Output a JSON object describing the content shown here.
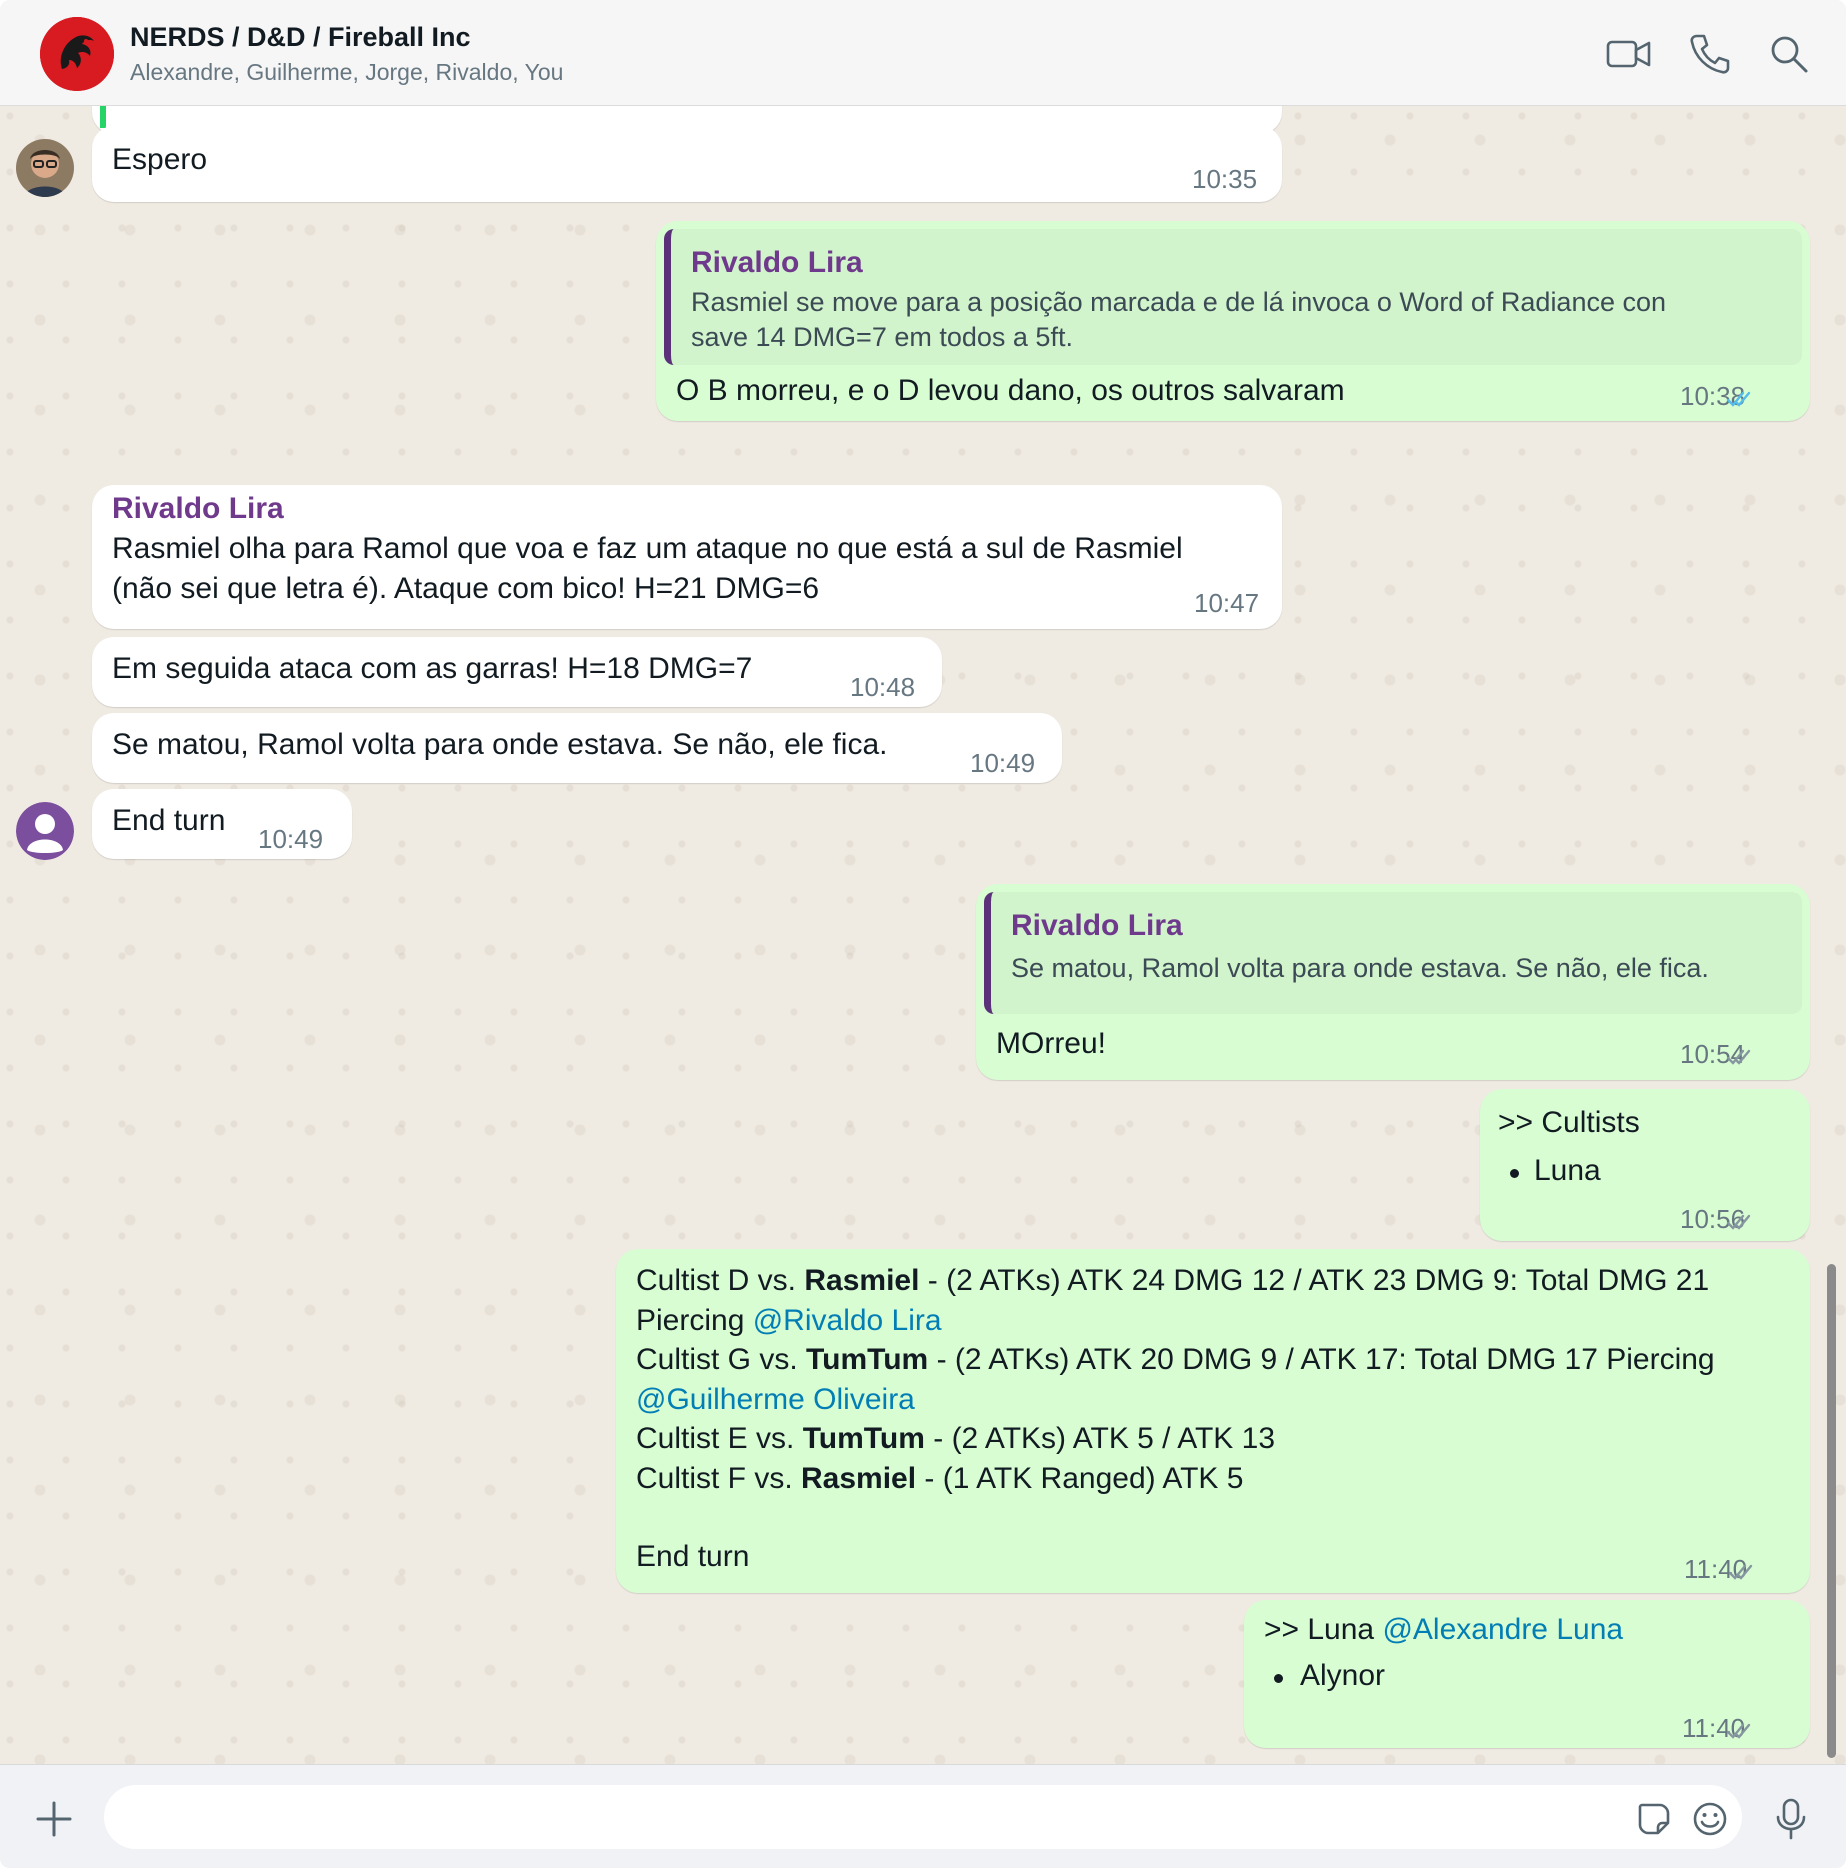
{
  "header": {
    "title": "NERDS / D&D / Fireball Inc",
    "participants": "Alexandre, Guilherme, Jorge, Rivaldo, You",
    "accent": "#d81b21"
  },
  "messages": [
    {
      "text": "Espero",
      "time": "10:35"
    },
    {
      "quote": {
        "name": "Rivaldo Lira",
        "line1": "Rasmiel se move para a posição marcada e de lá invoca o Word of Radiance con",
        "line2": "save 14 DMG=7 em todos a 5ft."
      },
      "text": "O B morreu, e o D levou dano, os outros salvaram",
      "time": "10:38",
      "status": "read"
    },
    {
      "sender": "Rivaldo Lira",
      "line1": "Rasmiel olha para Ramol que voa e faz um ataque no que está a sul de Rasmiel",
      "line2": "(não sei que letra é). Ataque com bico! H=21 DMG=6",
      "time": "10:47"
    },
    {
      "text": "Em seguida ataca com as garras! H=18 DMG=7",
      "time": "10:48"
    },
    {
      "text": "Se matou, Ramol volta para onde estava. Se não, ele fica.",
      "time": "10:49"
    },
    {
      "text": "End turn",
      "time": "10:49"
    },
    {
      "quote": {
        "name": "Rivaldo Lira",
        "line1": "Se matou, Ramol volta para onde estava. Se não, ele fica."
      },
      "text": "MOrreu!",
      "time": "10:54",
      "status": "delivered"
    },
    {
      "line1": ">> Cultists",
      "bullet": "Luna",
      "time": "10:56",
      "status": "delivered"
    },
    {
      "l1a": "Cultist D vs. ",
      "l1b": "Rasmiel",
      "l1c": " - (2 ATKs) ATK 24 DMG 12 / ATK 23 DMG 9: Total DMG 21",
      "l2a": "Piercing ",
      "l2m": "@Rivaldo Lira",
      "l3a": "Cultist G vs. ",
      "l3b": "TumTum",
      "l3c": " - (2 ATKs) ATK 20 DMG 9 / ATK 17: Total DMG 17 Piercing",
      "l4m": "@Guilherme Oliveira",
      "l5a": "Cultist E vs. ",
      "l5b": "TumTum",
      "l5c": " - (2 ATKs) ATK 5 / ATK 13",
      "l6a": "Cultist F vs. ",
      "l6b": "Rasmiel",
      "l6c": " - (1 ATK Ranged) ATK 5",
      "l7": "End turn",
      "time": "11:40",
      "status": "delivered"
    },
    {
      "l1a": ">> Luna ",
      "l1m": "@Alexandre Luna",
      "bullet": "Alynor",
      "time": "11:40",
      "status": "delivered"
    }
  ],
  "composer": {
    "placeholder": ""
  },
  "colors": {
    "outgoing": "#d9fdd3",
    "incoming": "#ffffff",
    "read_ticks": "#53bdeb",
    "mention": "#027eb5"
  }
}
